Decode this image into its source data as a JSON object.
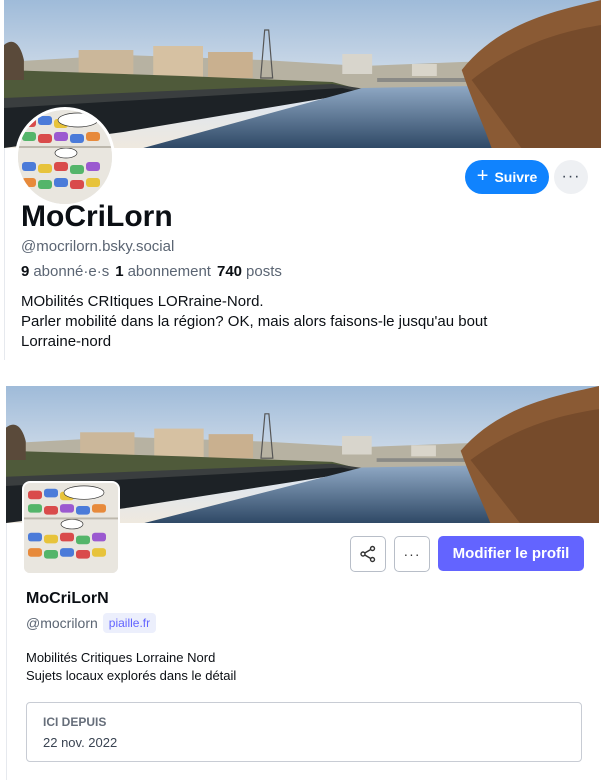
{
  "bluesky": {
    "banner_icon": "canal-landscape-image",
    "avatar_icon": "cartoon-traffic-jam-avatar",
    "follow_label": "Suivre",
    "more_label": "···",
    "display_name": "MoCriLorn",
    "handle": "@mocrilorn.bsky.social",
    "followers_count": "9",
    "followers_label": "abonné·e·s",
    "following_count": "1",
    "following_label": "abonnement",
    "posts_count": "740",
    "posts_label": "posts",
    "bio": [
      "MObilités CRItiques LORraine-Nord.",
      "Parler mobilité dans la région? OK, mais alors faisons-le jusqu'au bout",
      "Lorraine-nord"
    ],
    "accent_color": "#1083fe"
  },
  "mastodon": {
    "banner_icon": "canal-landscape-image",
    "avatar_icon": "cartoon-traffic-jam-avatar",
    "share_icon": "share-icon",
    "more_label": "···",
    "edit_label": "Modifier le profil",
    "display_name": "MoCriLorN",
    "handle": "@mocrilorn",
    "domain": "piaille.fr",
    "bio": [
      "Mobilités Critiques Lorraine Nord",
      "Sujets locaux explorés dans le détail"
    ],
    "since_label": "ICI DEPUIS",
    "since_value": "22 nov. 2022",
    "accent_color": "#6364ff"
  }
}
